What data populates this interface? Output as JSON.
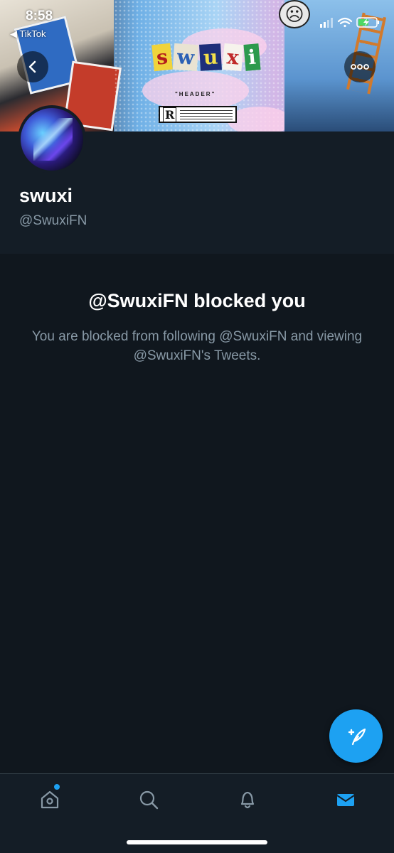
{
  "status_bar": {
    "time": "8:58",
    "back_app": "◀ TikTok"
  },
  "banner": {
    "logo_letters": [
      "s",
      "w",
      "u",
      "x",
      "i"
    ],
    "caption": "\"HEADER\"",
    "rating_letter": "R"
  },
  "profile": {
    "display_name": "swuxi",
    "handle": "@SwuxiFN"
  },
  "blocked": {
    "title": "@SwuxiFN blocked you",
    "description": "You are blocked from following @SwuxiFN and viewing @SwuxiFN's Tweets."
  },
  "tabs": [
    {
      "name": "home",
      "icon": "home-icon"
    },
    {
      "name": "search",
      "icon": "search-icon"
    },
    {
      "name": "notifications",
      "icon": "bell-icon"
    },
    {
      "name": "messages",
      "icon": "mail-icon"
    }
  ],
  "colors": {
    "accent": "#1da1f2",
    "background": "#10171e",
    "surface": "#141d26",
    "secondary_text": "#8899a6"
  }
}
